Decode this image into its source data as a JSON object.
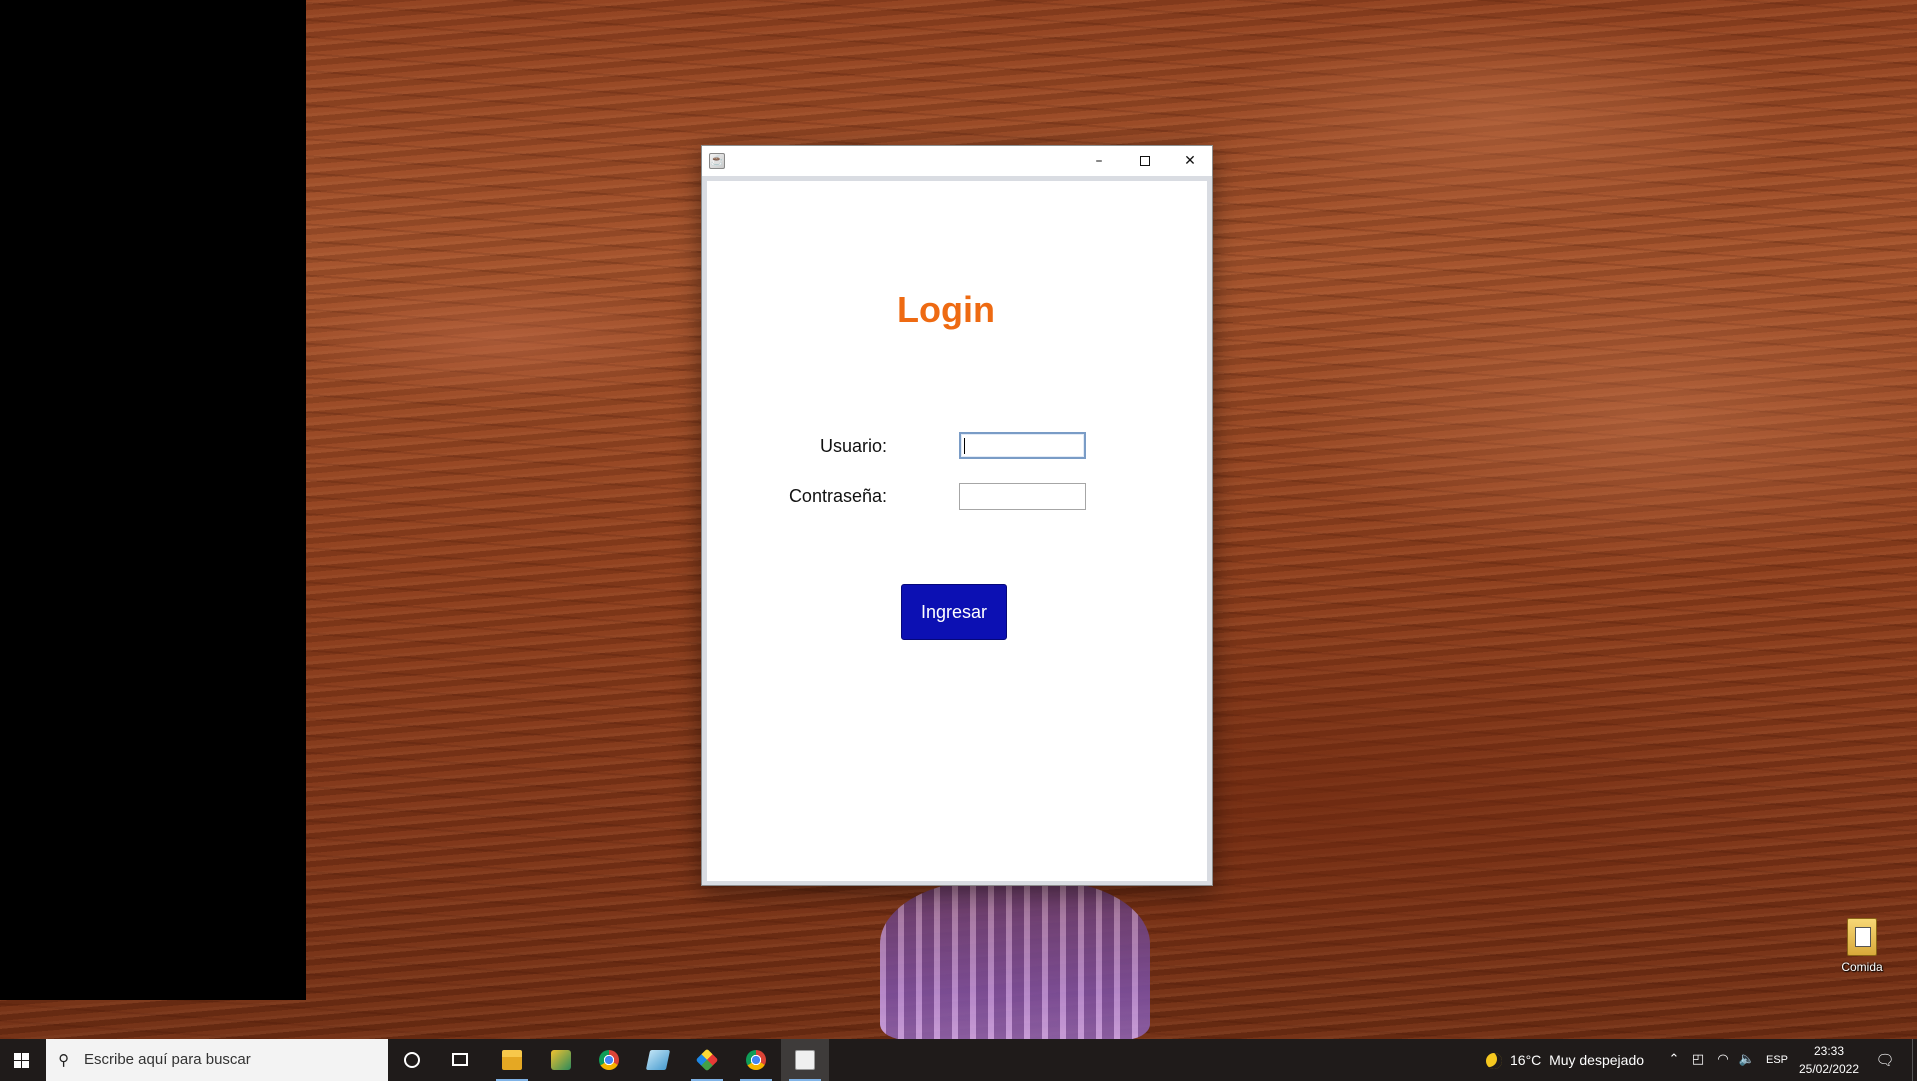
{
  "window": {
    "title": "",
    "minimize_glyph": "–",
    "close_glyph": "✕",
    "login_title": "Login",
    "user_label": "Usuario:",
    "user_value": "",
    "password_label": "Contraseña:",
    "password_value": "",
    "submit_label": "Ingresar",
    "accent_title_color": "#ee6a12",
    "button_color": "#0c10b3"
  },
  "desktop": {
    "icons": [
      {
        "label": "Comida",
        "icon": "file-icon"
      }
    ]
  },
  "taskbar": {
    "search_placeholder": "Escribe aquí para buscar",
    "pinned_apps": [
      {
        "name": "cortana",
        "icon": "circle-icon"
      },
      {
        "name": "task-view",
        "icon": "task-view-icon"
      },
      {
        "name": "file-explorer",
        "icon": "folder-icon",
        "active": true
      },
      {
        "name": "app",
        "icon": "app-icon"
      },
      {
        "name": "chrome",
        "icon": "chrome-icon"
      },
      {
        "name": "notepad",
        "icon": "notepad-icon"
      },
      {
        "name": "cube-app",
        "icon": "cube-icon",
        "active": true
      },
      {
        "name": "chrome-profile",
        "icon": "chrome-icon",
        "active": true
      },
      {
        "name": "java",
        "icon": "java-icon",
        "active": true,
        "current": true
      }
    ],
    "weather": {
      "temperature": "16°C",
      "condition": "Muy despejado"
    },
    "language": "ESP",
    "time": "23:33",
    "date": "25/02/2022"
  }
}
